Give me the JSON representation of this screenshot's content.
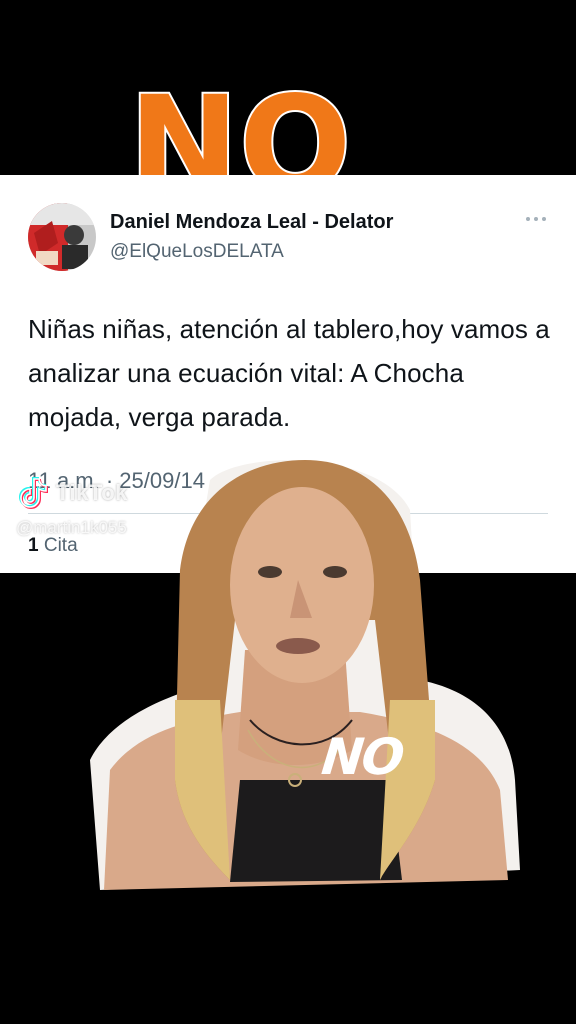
{
  "overlay": {
    "headline": "NO",
    "caption": "NO",
    "headline_color": "#f07818"
  },
  "tweet": {
    "display_name": "Daniel Mendoza Leal - Delator",
    "handle": "@ElQueLosDELATA",
    "text": "Niñas niñas, atención al tablero,hoy vamos a analizar una ecuación vital: A Chocha mojada, verga parada.",
    "meta": "11 a.m. · 25/09/14",
    "quote_count": "1",
    "quote_label": "Cita",
    "more_icon": "more-horizontal-icon"
  },
  "watermark": {
    "platform": "TikTok",
    "username": "@martin1k055",
    "icon": "tiktok-logo-icon"
  },
  "colors": {
    "background": "#000000",
    "card": "#ffffff",
    "name": "#0f1419",
    "secondary": "#536471"
  }
}
